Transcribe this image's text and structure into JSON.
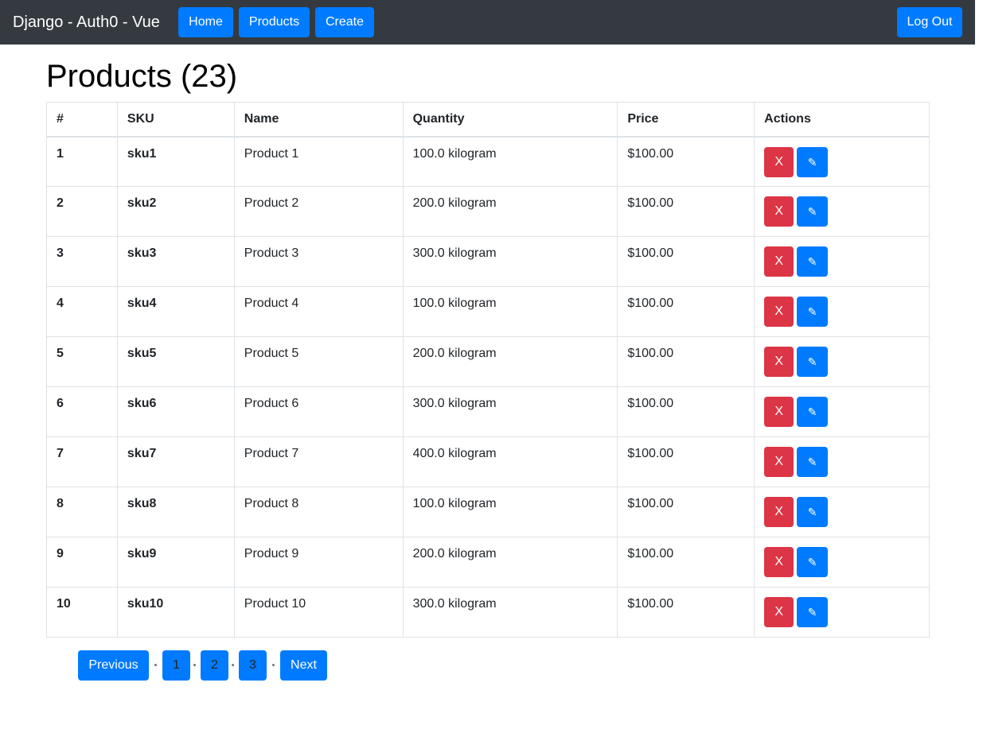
{
  "navbar": {
    "brand": "Django - Auth0 - Vue",
    "home_label": "Home",
    "products_label": "Products",
    "create_label": "Create",
    "logout_label": "Log Out"
  },
  "page": {
    "title": "Products (23)"
  },
  "table": {
    "headers": [
      "#",
      "SKU",
      "Name",
      "Quantity",
      "Price",
      "Actions"
    ],
    "delete_label": "X",
    "edit_icon": "pencil-icon",
    "edit_label": "✎",
    "rows": [
      {
        "num": "1",
        "sku": "sku1",
        "name": "Product 1",
        "quantity": "100.0 kilogram",
        "price": "$100.00"
      },
      {
        "num": "2",
        "sku": "sku2",
        "name": "Product 2",
        "quantity": "200.0 kilogram",
        "price": "$100.00"
      },
      {
        "num": "3",
        "sku": "sku3",
        "name": "Product 3",
        "quantity": "300.0 kilogram",
        "price": "$100.00"
      },
      {
        "num": "4",
        "sku": "sku4",
        "name": "Product 4",
        "quantity": "100.0 kilogram",
        "price": "$100.00"
      },
      {
        "num": "5",
        "sku": "sku5",
        "name": "Product 5",
        "quantity": "200.0 kilogram",
        "price": "$100.00"
      },
      {
        "num": "6",
        "sku": "sku6",
        "name": "Product 6",
        "quantity": "300.0 kilogram",
        "price": "$100.00"
      },
      {
        "num": "7",
        "sku": "sku7",
        "name": "Product 7",
        "quantity": "400.0 kilogram",
        "price": "$100.00"
      },
      {
        "num": "8",
        "sku": "sku8",
        "name": "Product 8",
        "quantity": "100.0 kilogram",
        "price": "$100.00"
      },
      {
        "num": "9",
        "sku": "sku9",
        "name": "Product 9",
        "quantity": "200.0 kilogram",
        "price": "$100.00"
      },
      {
        "num": "10",
        "sku": "sku10",
        "name": "Product 10",
        "quantity": "300.0 kilogram",
        "price": "$100.00"
      }
    ]
  },
  "pagination": {
    "previous_label": "Previous",
    "pages": [
      "1",
      "2",
      "3"
    ],
    "next_label": "Next"
  },
  "colors": {
    "navbar_bg": "#343a40",
    "primary": "#007bff",
    "danger": "#dc3545"
  }
}
